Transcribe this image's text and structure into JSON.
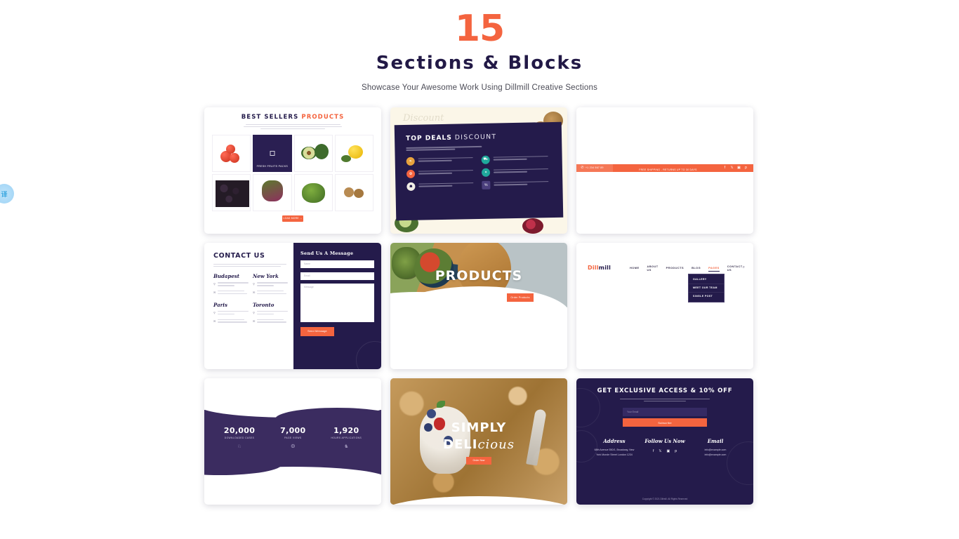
{
  "header": {
    "count": "15",
    "title": "Sections & Blocks",
    "subtitle": "Showcase Your Awesome Work Using Dillmill Creative Sections"
  },
  "colors": {
    "accent": "#f4643f",
    "dark": "#241b4b",
    "band": "#3b2c60",
    "cream": "#fbf6e8"
  },
  "edge_widget": {
    "label": "译"
  },
  "cards": {
    "best_sellers": {
      "title_main": "BEST SELLERS",
      "title_accent": "PRODUCTS",
      "dark_tile_label": "FRESH FRUITS PACKS",
      "button_label": "LOAD MORE →"
    },
    "top_deals": {
      "script_word": "Discount",
      "title_main": "TOP DEALS",
      "title_thin": "DISCOUNT",
      "items": [
        {
          "icon": "leaf-icon",
          "color": "#e8a33d"
        },
        {
          "icon": "apple-icon",
          "color": "#f4643f"
        },
        {
          "icon": "basket-icon",
          "color": "#f2efe6"
        },
        {
          "icon": "truck-icon",
          "color": "#1fa89b"
        },
        {
          "icon": "gift-icon",
          "color": "#1fa89b"
        },
        {
          "icon": "percent-icon",
          "color": "#2b2257"
        }
      ]
    },
    "topbar": {
      "left_label": "+1 234 567 89",
      "center_label": "FREE SHIPPING - RETURNS UP TO 30 DAYS",
      "socials": [
        "f",
        "t",
        "i",
        "p"
      ]
    },
    "contact": {
      "title": "CONTACT US",
      "form_title": "Send Us A Message",
      "name_placeholder": "Name",
      "email_placeholder": "Email",
      "message_placeholder": "Message",
      "submit_label": "Send Message",
      "cities": [
        {
          "name": "Budapest",
          "address_icon": "pin-icon",
          "mail_icon": "mail-icon"
        },
        {
          "name": "New York",
          "address_icon": "pin-icon",
          "mail_icon": "mail-icon"
        },
        {
          "name": "Paris",
          "address_icon": "pin-icon",
          "mail_icon": "mail-icon"
        },
        {
          "name": "Toronto",
          "address_icon": "pin-icon",
          "mail_icon": "mail-icon"
        }
      ]
    },
    "products": {
      "title": "PRODUCTS",
      "button_label": "Order Products"
    },
    "navigation": {
      "logo_a": "Dill",
      "logo_b": "mill",
      "menu": [
        "HOME",
        "ABOUT US",
        "PRODUCTS",
        "BLOG",
        "PAGES",
        "CONTACT US"
      ],
      "active_index": 4,
      "search_icon": "search-icon",
      "dropdown": [
        "GALLERY",
        "MEET OUR TEAM",
        "SINGLE POST"
      ]
    },
    "stats": {
      "items": [
        {
          "value": "20,000",
          "label": "DOWNLOADED CASES",
          "icon": "trophy-icon"
        },
        {
          "value": "7,000",
          "label": "PAGE VIEWS",
          "icon": "eye-icon"
        },
        {
          "value": "1,920",
          "label": "HOURS APPLICATIONS",
          "icon": "clock-icon"
        }
      ]
    },
    "simply": {
      "line1": "SIMPLY",
      "line2_bold": "DELI",
      "line2_script": "cious",
      "button_label": "Order Now"
    },
    "footer": {
      "title": "GET EXCLUSIVE ACCESS & 10% OFF",
      "email_placeholder": "Your Email",
      "subscribe_label": "Subscribe",
      "columns": [
        {
          "heading": "Address",
          "line1": "68th Avenue 550/1, Broadway, New",
          "line2": "York Monde Street London 1234"
        },
        {
          "heading": "Follow Us Now",
          "socials": [
            "f",
            "t",
            "i",
            "p"
          ]
        },
        {
          "heading": "Email",
          "line1": "info@example.com",
          "line2": "info@example.com"
        }
      ],
      "copyright": "Copyright © 2021 Dillmill. All Rights Reserved"
    }
  }
}
